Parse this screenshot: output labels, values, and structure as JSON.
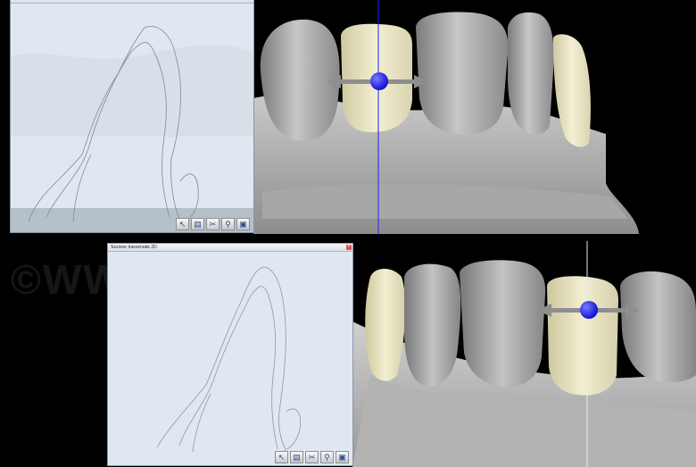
{
  "top_panel": {
    "title": "",
    "toolbar": [
      {
        "name": "cursor-tool-icon",
        "glyph": "↖"
      },
      {
        "name": "printer-icon",
        "glyph": "▤"
      },
      {
        "name": "scissors-icon",
        "glyph": "✂"
      },
      {
        "name": "magnifier-icon",
        "glyph": "⚲"
      },
      {
        "name": "image-export-icon",
        "glyph": "▣"
      }
    ]
  },
  "bottom_panel": {
    "title": "Sezione trasversale 2D",
    "toolbar": [
      {
        "name": "cursor-tool-icon",
        "glyph": "↖"
      },
      {
        "name": "printer-icon",
        "glyph": "▤"
      },
      {
        "name": "scissors-icon",
        "glyph": "✂"
      },
      {
        "name": "magnifier-icon",
        "glyph": "⚲"
      },
      {
        "name": "image-export-icon",
        "glyph": "▣"
      }
    ]
  },
  "watermark": "©WW",
  "colors": {
    "panel_bg": "#dfe8f1",
    "tooth_gray": "#b9b9b9",
    "crown_ivory": "#ece8c6",
    "manipulator_blue": "#1010e0",
    "arrow_gray": "#8e8e8e"
  }
}
